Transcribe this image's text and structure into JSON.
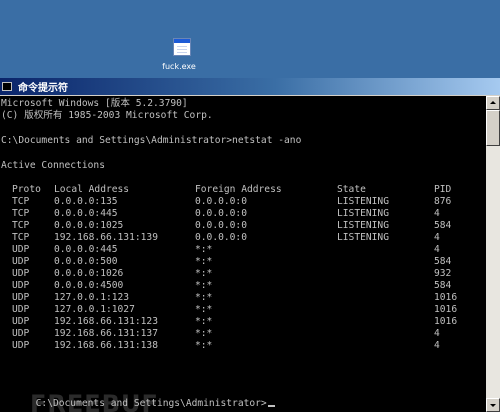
{
  "desktop": {
    "icon_label": "fuck.exe",
    "icon": "executable-file-icon"
  },
  "window": {
    "title": "命令提示符",
    "title_icon": "cmd-icon"
  },
  "console": {
    "banner": [
      "Microsoft Windows [版本 5.2.3790]",
      "(C) 版权所有 1985-2003 Microsoft Corp."
    ],
    "command_line": "C:\\Documents and Settings\\Administrator>netstat -ano",
    "section_title": "Active Connections",
    "headers": [
      "Proto",
      "Local Address",
      "Foreign Address",
      "State",
      "PID"
    ],
    "rows": [
      [
        "TCP",
        "0.0.0.0:135",
        "0.0.0.0:0",
        "LISTENING",
        "876"
      ],
      [
        "TCP",
        "0.0.0.0:445",
        "0.0.0.0:0",
        "LISTENING",
        "4"
      ],
      [
        "TCP",
        "0.0.0.0:1025",
        "0.0.0.0:0",
        "LISTENING",
        "584"
      ],
      [
        "TCP",
        "192.168.66.131:139",
        "0.0.0.0:0",
        "LISTENING",
        "4"
      ],
      [
        "UDP",
        "0.0.0.0:445",
        "*:*",
        "",
        "4"
      ],
      [
        "UDP",
        "0.0.0.0:500",
        "*:*",
        "",
        "584"
      ],
      [
        "UDP",
        "0.0.0.0:1026",
        "*:*",
        "",
        "932"
      ],
      [
        "UDP",
        "0.0.0.0:4500",
        "*:*",
        "",
        "584"
      ],
      [
        "UDP",
        "127.0.0.1:123",
        "*:*",
        "",
        "1016"
      ],
      [
        "UDP",
        "127.0.0.1:1027",
        "*:*",
        "",
        "1016"
      ],
      [
        "UDP",
        "192.168.66.131:123",
        "*:*",
        "",
        "1016"
      ],
      [
        "UDP",
        "192.168.66.131:137",
        "*:*",
        "",
        "4"
      ],
      [
        "UDP",
        "192.168.66.131:138",
        "*:*",
        "",
        "4"
      ]
    ],
    "prompt": "C:\\Documents and Settings\\Administrator>",
    "watermark": "FREEBUF"
  },
  "colors": {
    "desktop": "#3a6ea5",
    "console_bg": "#000000",
    "console_text": "#c0c0c0"
  }
}
